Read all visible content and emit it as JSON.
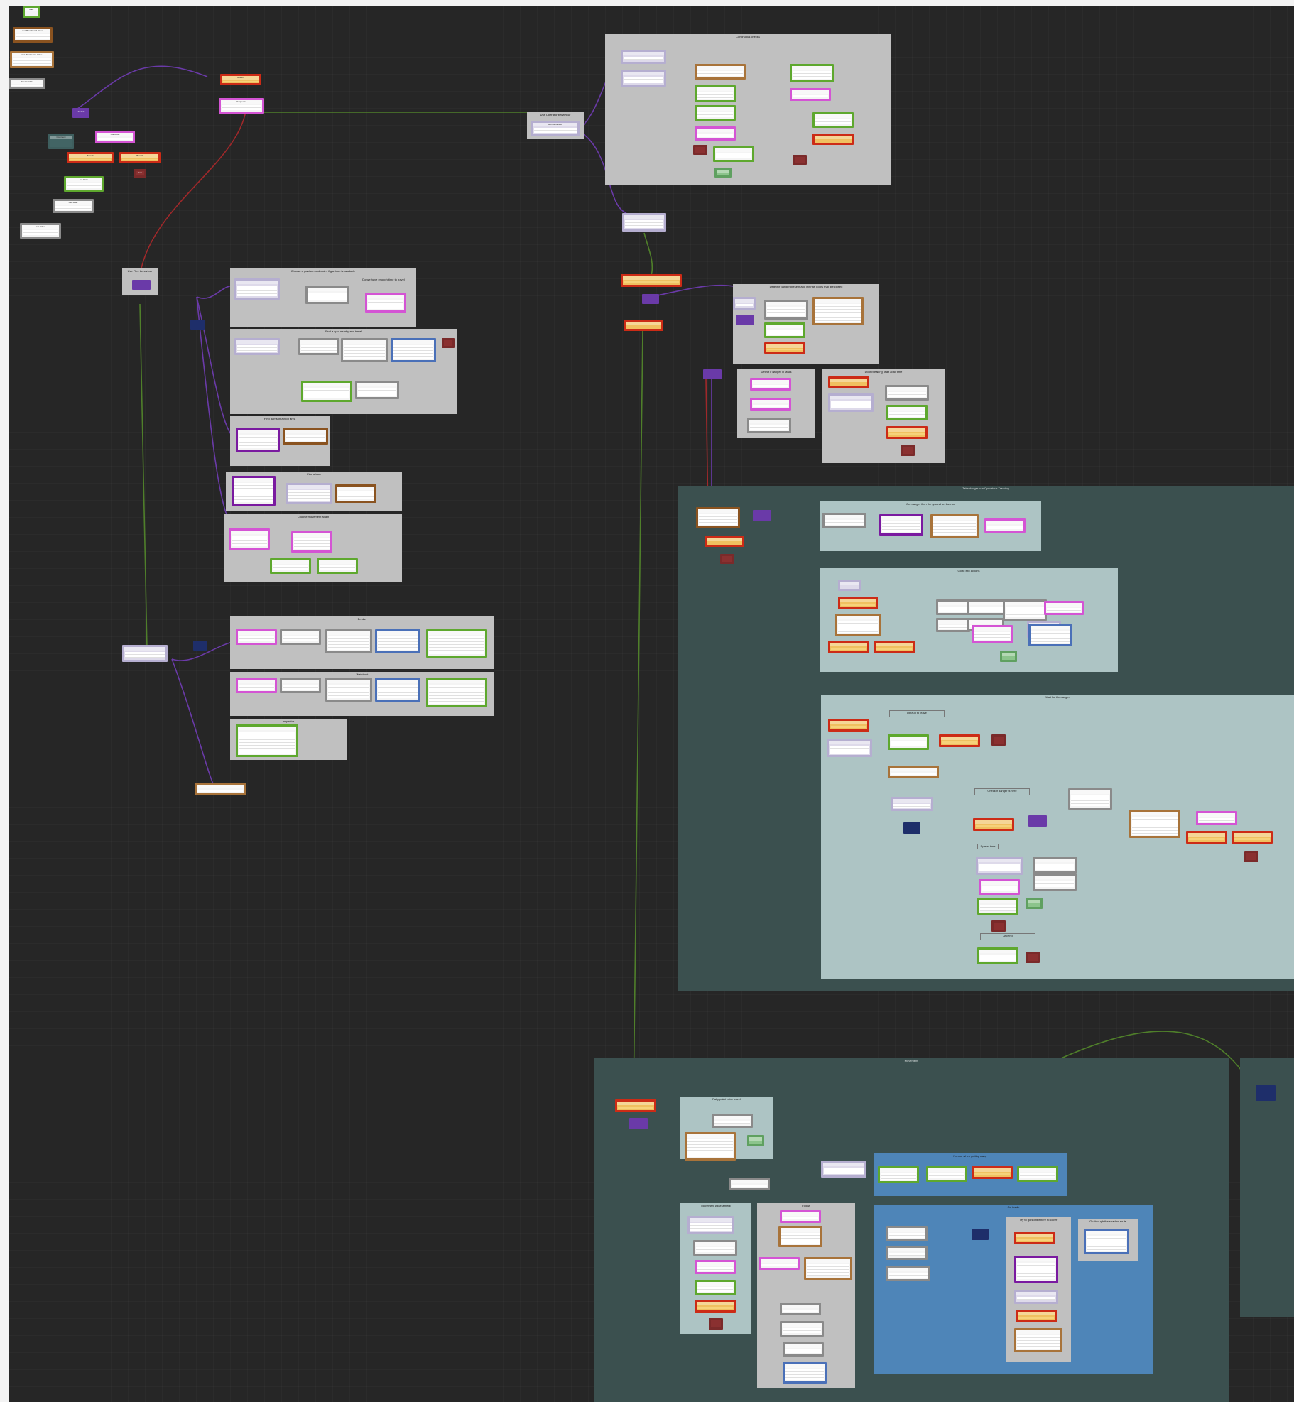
{
  "app": {
    "name": "Node graph editor",
    "colors": {
      "canvas": "#262626",
      "group_gray": "#c0c0c0",
      "group_teal": "#adc4c4",
      "group_dark": "#3b504f",
      "group_blue": "#4e85b8",
      "wire_purple": "#6a3aa8",
      "wire_green": "#4f7f2a",
      "wire_red": "#a0282a"
    }
  },
  "groups": [
    {
      "id": "g-continuous",
      "title": "Continuous checks",
      "color": "gray"
    },
    {
      "id": "g-bot-operator",
      "title": "Use Operator behaviour",
      "color": "gray"
    },
    {
      "id": "g-flee",
      "title": "Use Flee behaviour",
      "color": "gray"
    },
    {
      "id": "g-choose-garrison",
      "title": "Choose a garrison and claim if garrison is available",
      "color": "gray"
    },
    {
      "id": "g-not-enough-time",
      "title": "Do we have enough time to travel",
      "color": "gray"
    },
    {
      "id": "g-find-nearby",
      "title": "Find a spot nearby and travel",
      "color": "gray"
    },
    {
      "id": "g-find-garrison",
      "title": "Find garrison action area",
      "color": "gray"
    },
    {
      "id": "g-find-task",
      "title": "Find a task",
      "color": "gray"
    },
    {
      "id": "g-choose-movement",
      "title": "Choose movement again",
      "color": "gray"
    },
    {
      "id": "g-bunker",
      "title": "Bunker",
      "color": "gray"
    },
    {
      "id": "g-watchout",
      "title": "Watchout",
      "color": "gray"
    },
    {
      "id": "g-inspector",
      "title": "Inspector",
      "color": "gray"
    },
    {
      "id": "g-detect",
      "title": "Detect if danger present and if it has doors that are closed",
      "color": "gray"
    },
    {
      "id": "g-detect-danger",
      "title": "Detect if danger in tasks",
      "color": "gray"
    },
    {
      "id": "g-door-breaking",
      "title": "Door breaking, wait at all time",
      "color": "gray"
    },
    {
      "id": "g-danger-main",
      "title": "Take danger in a Operator's Tracking",
      "color": "dark"
    },
    {
      "id": "g-get-danger",
      "title": "Get danger if on the ground on the run",
      "color": "teal"
    },
    {
      "id": "g-go-to-exit",
      "title": "Go to exit actions",
      "color": "teal"
    },
    {
      "id": "g-wait-danger",
      "title": "Wait for the danger",
      "color": "teal"
    },
    {
      "id": "g-movement",
      "title": "Movement",
      "color": "dark"
    },
    {
      "id": "g-movement-right",
      "title": "",
      "color": "dark"
    },
    {
      "id": "g-rally-point",
      "title": "Rally point enter travel",
      "color": "teal"
    },
    {
      "id": "g-movement-sub",
      "title": "Movement Assessment",
      "color": "teal"
    },
    {
      "id": "g-follow",
      "title": "Follow",
      "color": "gray"
    },
    {
      "id": "g-normal-getting",
      "title": "Normal when getting away",
      "color": "blue"
    },
    {
      "id": "g-go-inside",
      "title": "Go inside",
      "color": "blue"
    },
    {
      "id": "g-try-cover",
      "title": "Try to go somewhere to cover",
      "color": "gray"
    },
    {
      "id": "g-go-shadow",
      "title": "Go through the shadow route",
      "color": "gray"
    }
  ],
  "notes": [
    {
      "id": "note-default-to-leave",
      "text": "Default to leave"
    },
    {
      "id": "note-check-to-leave",
      "text": "Check if danger is here"
    },
    {
      "id": "note-spawn-time",
      "text": "Spawn time"
    },
    {
      "id": "note-ascend",
      "text": "Ascend"
    },
    {
      "id": "note-side",
      "text": "Side note: travel until ready, leave after a small idle time"
    }
  ],
  "nodes": [
    {
      "id": "n-start",
      "label": "Start",
      "kind": "green"
    },
    {
      "id": "n-get-bb-1",
      "label": "Get Blackboard Value",
      "kind": "dbrown"
    },
    {
      "id": "n-get-bb-2",
      "label": "Get Blackboard Value",
      "kind": "brown"
    },
    {
      "id": "n-set-var-1",
      "label": "Set Variable",
      "kind": "gray"
    },
    {
      "id": "n-switch-1",
      "label": "Switch",
      "kind": "purple"
    },
    {
      "id": "n-branch-1",
      "label": "Branch",
      "kind": "red"
    },
    {
      "id": "n-sequence-1",
      "label": "Sequence",
      "kind": "pink"
    },
    {
      "id": "n-run-behaviour",
      "label": "Run Behaviour",
      "kind": "lav"
    },
    {
      "id": "n-comment-left",
      "label": "Comment",
      "kind": "slate"
    },
    {
      "id": "n-condition-1",
      "label": "Condition",
      "kind": "pink"
    },
    {
      "id": "n-branch-2",
      "label": "Branch",
      "kind": "red"
    },
    {
      "id": "n-branch-3",
      "label": "Branch",
      "kind": "red"
    },
    {
      "id": "n-fail-1",
      "label": "Fail",
      "kind": "maroon"
    },
    {
      "id": "n-set-state",
      "label": "Set State",
      "kind": "green"
    },
    {
      "id": "n-get-state",
      "label": "Get State",
      "kind": "gray"
    },
    {
      "id": "n-get-value",
      "label": "Get Value",
      "kind": "gray"
    }
  ],
  "watermark_text": ""
}
